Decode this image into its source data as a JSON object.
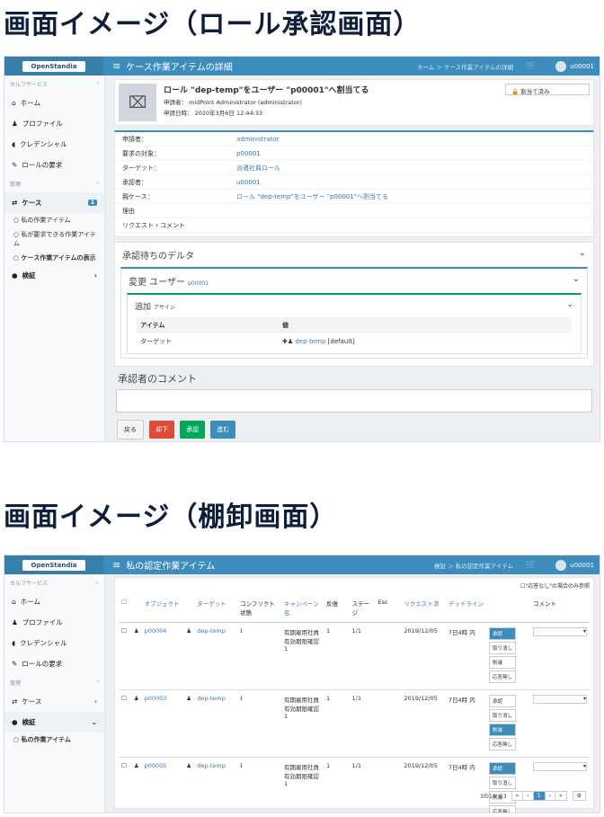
{
  "heading1": "画面イメージ（ロール承認画面）",
  "heading2": "画面イメージ（棚卸画面）",
  "logo": "OpenStandia",
  "s1": {
    "title": "ケース作業アイテムの詳細",
    "breadcrumb": "ホーム ＞ ケース作業アイテムの詳細",
    "user": "u00001",
    "sidebar": {
      "section1": "セルフサービス",
      "items": [
        "ホーム",
        "プロファイル",
        "クレデンシャル",
        "ロールの要求"
      ],
      "section2": "管理",
      "case": "ケース",
      "case_badge": "1",
      "subitems": [
        "私の作業アイテム",
        "私が要求できる作業アイテム",
        "ケース作業アイテムの表示"
      ],
      "verify": "検証"
    },
    "header": {
      "title": "ロール \"dep-temp\"をユーザー \"p00001\"へ割当てる",
      "requester": "申請者： midPoint Administrator (administrator)",
      "date": "申請日時： 2020年3月6日 12:44:33",
      "assigned": "割当て済み"
    },
    "fields": [
      {
        "k": "申請者：",
        "v": "administrator"
      },
      {
        "k": "要求の対象：",
        "v": "p00001"
      },
      {
        "k": "ターゲット：",
        "v": "派遣社員ロール"
      },
      {
        "k": "承認者：",
        "v": "u00001"
      },
      {
        "k": "親ケース：",
        "v": "ロール \"dep-temp\"をユーザー \"p00001\"へ割当てる"
      },
      {
        "k": "理由",
        "v": ""
      },
      {
        "k": "リクエスト・コメント",
        "v": ""
      }
    ],
    "delta_title": "承認待ちのデルタ",
    "change": {
      "label": "変更 ユーザー",
      "target": "p00001"
    },
    "add": {
      "label": "追加",
      "sub": "アサイン"
    },
    "table": {
      "col1": "アイテム",
      "col2": "値",
      "row_label": "ターゲット",
      "row_value": "dep-temp",
      "row_suffix": "[default]"
    },
    "comment_title": "承認者のコメント",
    "buttons": {
      "back": "戻る",
      "reject": "却下",
      "approve": "承認",
      "forward": "進む"
    }
  },
  "s2": {
    "title": "私の認定作業アイテム",
    "breadcrumb": "検証 ＞ 私の認定作業アイテム",
    "user": "u00001",
    "sidebar": {
      "section1": "セルフサービス",
      "items": [
        "ホーム",
        "プロファイル",
        "クレデンシャル",
        "ロールの要求"
      ],
      "section2": "管理",
      "case": "ケース",
      "verify": "検証",
      "sub": "私の作業アイテム"
    },
    "filter": "\"応答なし\"の場合のみ参照",
    "columns": [
      "オブジェクト",
      "ターゲット",
      "コンフリクト状態",
      "キャンペーン名",
      "反復",
      "ステージ",
      "Esc",
      "リクエスト済",
      "デッドライン",
      "コメント"
    ],
    "rows": [
      {
        "obj": "p00004",
        "target": "dep-temp",
        "campaign": "有期雇用社員有効期限確認1",
        "iter": "1",
        "stage": "1/1",
        "req": "2019/12/05",
        "deadline": "7日4時 内"
      },
      {
        "obj": "p00003",
        "target": "dep-temp",
        "campaign": "有期雇用社員有効期限確認1",
        "iter": "1",
        "stage": "1/1",
        "req": "2019/12/05",
        "deadline": "7日4時 内"
      },
      {
        "obj": "p00005",
        "target": "dep-temp",
        "campaign": "有期雇用社員有効期限確認1",
        "iter": "1",
        "stage": "1/1",
        "req": "2019/12/05",
        "deadline": "7日4時 内"
      }
    ],
    "actions": [
      "承認",
      "取り消し",
      "削減",
      "応答無し"
    ],
    "paging": "3の1から3",
    "page": "1"
  }
}
